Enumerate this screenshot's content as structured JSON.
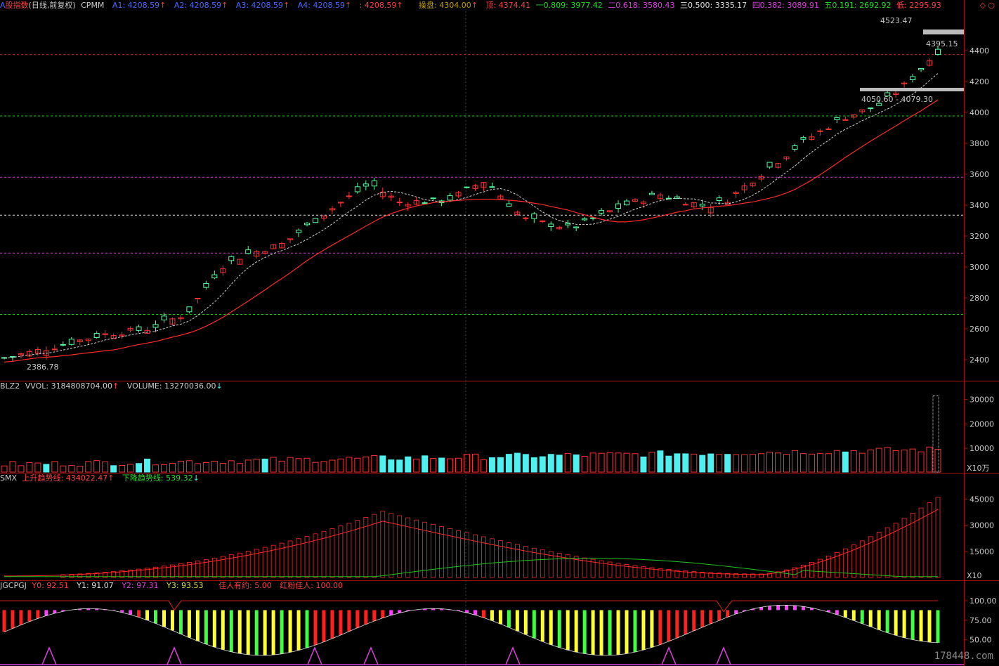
{
  "price_header": {
    "prefix": "A",
    "name": "股指数",
    "mode": "(日线,前复权)",
    "indicator": "CPMM",
    "a1": "A1: 4208.59",
    "a2": "A2: 4208.59",
    "a3": "A3: 4208.59",
    "a4": "A4: 4208.59",
    "a5": ": 4208.59",
    "pan": "操盘: 4304.00",
    "top": "顶: 4374.41",
    "f1": "一0.809: 3977.42",
    "f2": "二0.618: 3580.43",
    "f3": "三0.500: 3335.17",
    "f4": "四0.382: 3089.91",
    "f5": "五0.191: 2692.92",
    "low": "低: 2295.93"
  },
  "price_annotations": {
    "high_label": "4523.47",
    "low_label": "2386.78",
    "box_upper": "4395.15",
    "box_lower": "4050.60 - 4079.30"
  },
  "price_axis": [
    "4400",
    "4200",
    "4000",
    "3800",
    "3600",
    "3400",
    "3200",
    "3000",
    "2800",
    "2600",
    "2400"
  ],
  "volume_header": {
    "name": "BLZ2",
    "vvol": "VVOL: 3184808704.00",
    "volume": "VOLUME: 13270036.00"
  },
  "volume_axis": [
    "30000",
    "20000",
    "10000"
  ],
  "volume_unit": "X10万",
  "trend_header": {
    "name": "SMX",
    "up": "上升趋势线: 434022.47",
    "down": "下降趋势线: 539.32"
  },
  "trend_axis": [
    "45000",
    "30000",
    "15000"
  ],
  "trend_unit": "X10",
  "osc_header": {
    "name": "JGCPGJ",
    "y0": "Y0: 92.51",
    "y1": "Y1: 91.07",
    "y2": "Y2: 97.31",
    "y3": "Y3: 93.53",
    "p1": "佳人有约: 5.00",
    "p2": "红粉佳人: 100.00"
  },
  "osc_axis": [
    "100.00",
    "75.00",
    "50.00"
  ],
  "watermark": "178448.com",
  "colors": {
    "up": "#ff3030",
    "down": "#54ff9f",
    "vol_up": "#ff3030",
    "vol_down": "#4ef0f0",
    "ma_red": "#ff2a2a",
    "ma_dash": "#d0d0d0",
    "fib_green": "#22c322",
    "fib_magenta": "#c040c0",
    "fib_white": "#e0e0e0",
    "fib_red": "#b03030",
    "axis_text": "#c8c8c8",
    "header_blue": "#4a6cff"
  }
}
